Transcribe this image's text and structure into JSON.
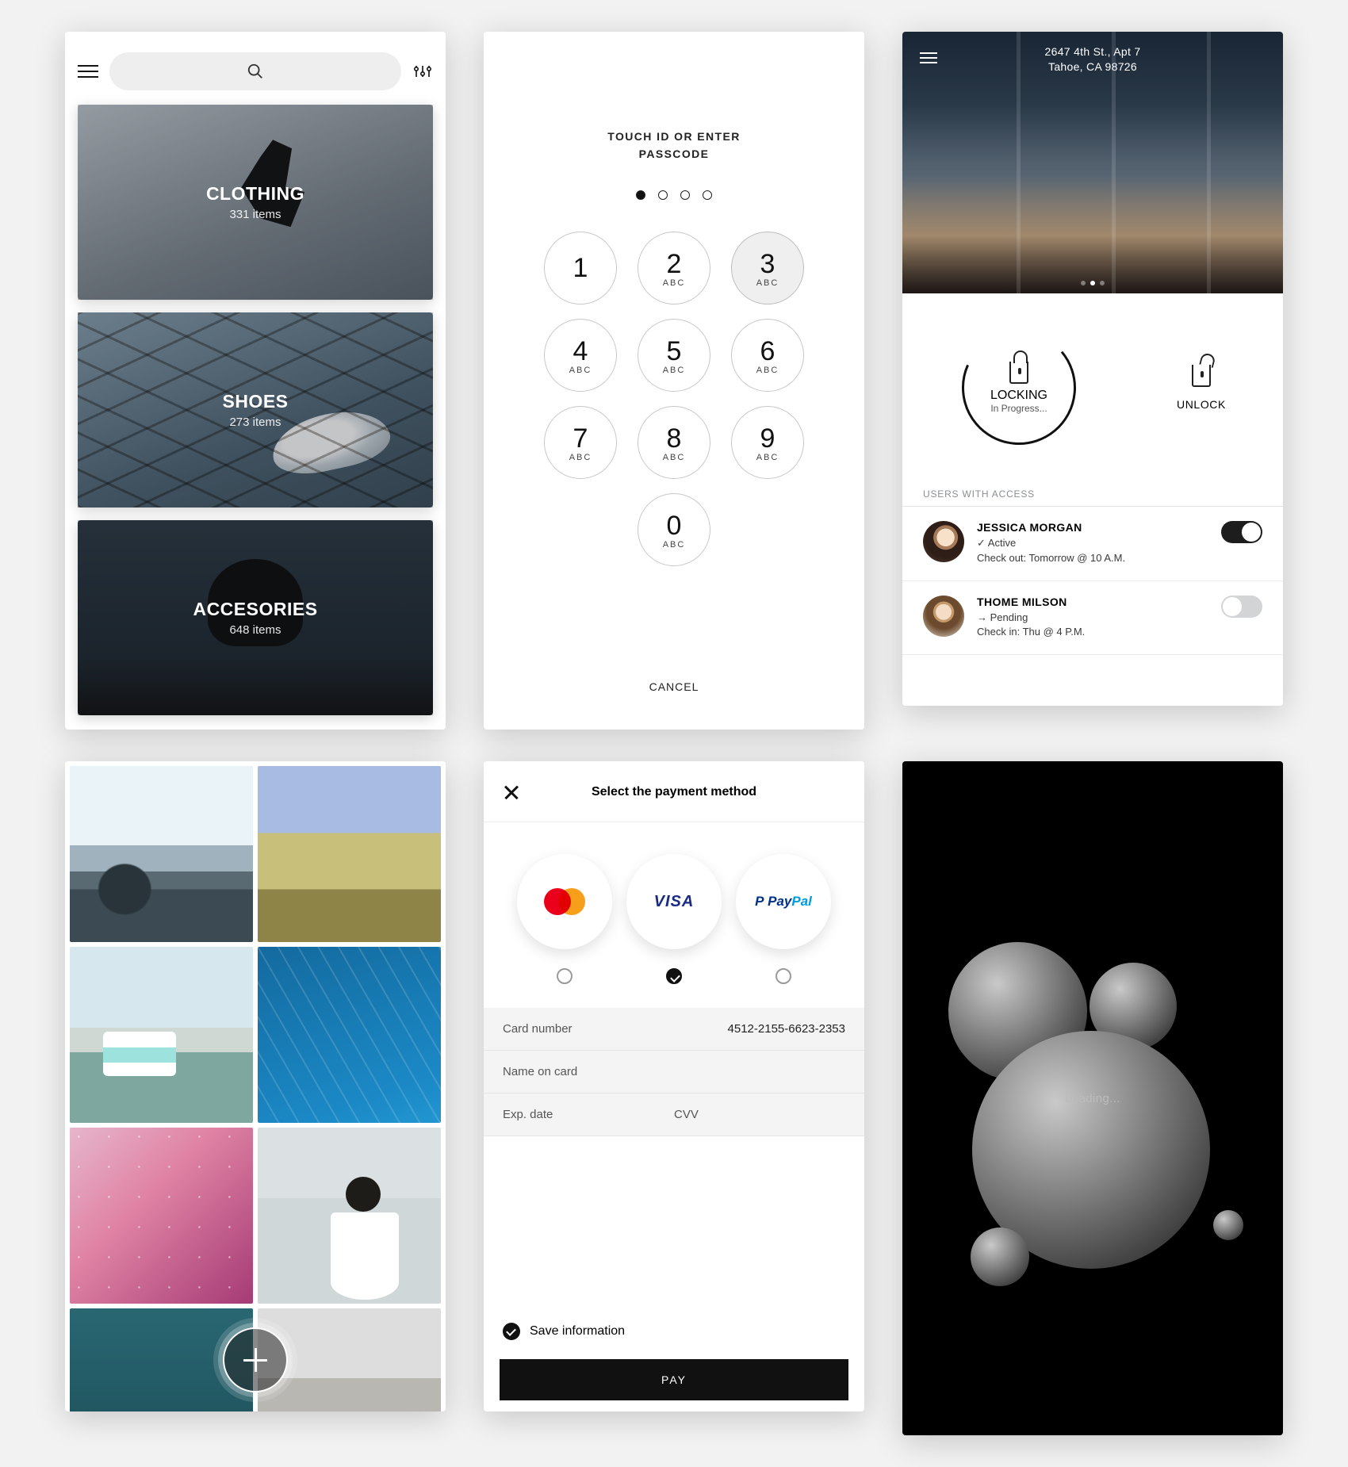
{
  "shop": {
    "categories": [
      {
        "title": "CLOTHING",
        "count": "331 items"
      },
      {
        "title": "SHOES",
        "count": "273 items"
      },
      {
        "title": "ACCESORIES",
        "count": "648 items"
      }
    ]
  },
  "passcode": {
    "heading_line1": "TOUCH ID OR ENTER",
    "heading_line2": "PASSCODE",
    "keys": [
      {
        "num": "1",
        "sub": ""
      },
      {
        "num": "2",
        "sub": "ABC"
      },
      {
        "num": "3",
        "sub": "ABC"
      },
      {
        "num": "4",
        "sub": "ABC"
      },
      {
        "num": "5",
        "sub": "ABC"
      },
      {
        "num": "6",
        "sub": "ABC"
      },
      {
        "num": "7",
        "sub": "ABC"
      },
      {
        "num": "8",
        "sub": "ABC"
      },
      {
        "num": "9",
        "sub": "ABC"
      },
      {
        "num": "0",
        "sub": "ABC"
      }
    ],
    "pressed_index": 2,
    "dots_filled": 1,
    "dots_total": 4,
    "cancel": "CANCEL"
  },
  "lock": {
    "address_line1": "2647 4th St., Apt 7",
    "address_line2": "Tahoe, CA 98726",
    "locking_label": "LOCKING",
    "locking_sub": "In Progress...",
    "unlock_label": "UNLOCK",
    "section_title": "USERS WITH ACCESS",
    "users": [
      {
        "name": "JESSICA MORGAN",
        "status": "✓ Active",
        "detail": "Check out: Tomorrow @ 10 A.M.",
        "toggled": true
      },
      {
        "name": "THOME MILSON",
        "status": "→ Pending",
        "detail": "Check in: Thu @ 4 P.M.",
        "toggled": false
      }
    ]
  },
  "payment": {
    "title": "Select the payment method",
    "methods": [
      {
        "name": "MasterCard",
        "selected": false
      },
      {
        "name": "VISA",
        "selected": true
      },
      {
        "name": "PayPal",
        "selected": false
      }
    ],
    "fields": {
      "card_number_label": "Card number",
      "card_number_value": "4512-2155-6623-2353",
      "name_label": "Name on card",
      "exp_label": "Exp. date",
      "cvv_label": "CVV"
    },
    "save_label": "Save information",
    "pay_button": "PAY"
  },
  "loading": {
    "text": "Loading..."
  }
}
